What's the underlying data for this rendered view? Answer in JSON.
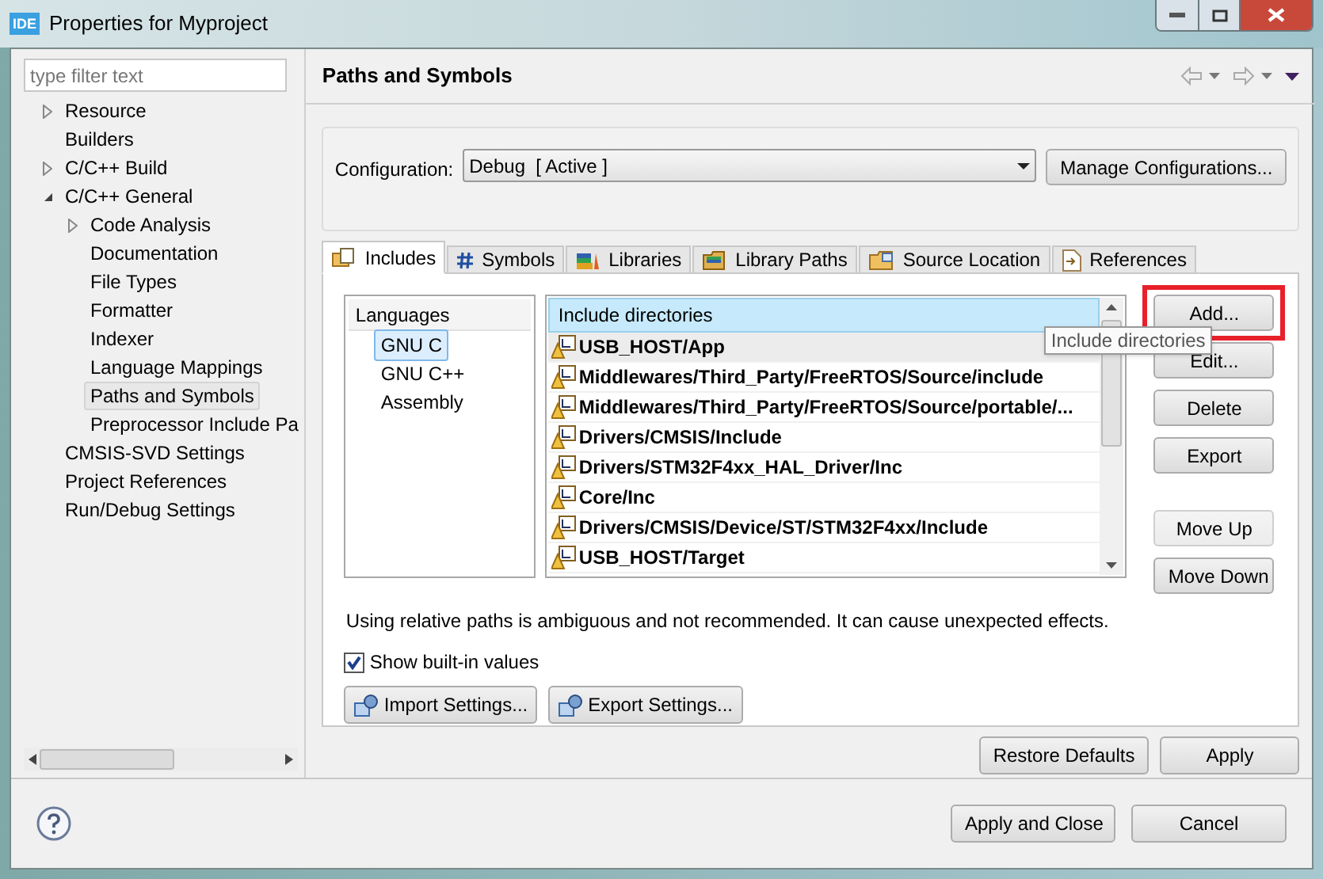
{
  "window": {
    "title": "Properties for Myproject",
    "app_badge": "IDE"
  },
  "filter": {
    "placeholder": "type filter text"
  },
  "tree": [
    {
      "label": "Resource",
      "expanded": false,
      "selected": false
    },
    {
      "label": "Builders",
      "selected": false
    },
    {
      "label": "C/C++ Build",
      "expanded": false,
      "selected": false
    },
    {
      "label": "C/C++ General",
      "expanded": true,
      "selected": false,
      "children": [
        {
          "label": "Code Analysis",
          "expanded": false,
          "selected": false
        },
        {
          "label": "Documentation",
          "selected": false
        },
        {
          "label": "File Types",
          "selected": false
        },
        {
          "label": "Formatter",
          "selected": false
        },
        {
          "label": "Indexer",
          "selected": false
        },
        {
          "label": "Language Mappings",
          "selected": false
        },
        {
          "label": "Paths and Symbols",
          "selected": true
        },
        {
          "label": "Preprocessor Include Pa",
          "selected": false
        }
      ]
    },
    {
      "label": "CMSIS-SVD Settings",
      "selected": false
    },
    {
      "label": "Project References",
      "selected": false
    },
    {
      "label": "Run/Debug Settings",
      "selected": false
    }
  ],
  "page": {
    "title": "Paths and Symbols"
  },
  "configuration": {
    "label": "Configuration:",
    "value": "Debug  [ Active ]",
    "manage_button": "Manage Configurations..."
  },
  "tabs": [
    {
      "label": "Includes",
      "selected": true
    },
    {
      "label": "Symbols",
      "selected": false
    },
    {
      "label": "Libraries",
      "selected": false
    },
    {
      "label": "Library Paths",
      "selected": false
    },
    {
      "label": "Source Location",
      "selected": false
    },
    {
      "label": "References",
      "selected": false
    }
  ],
  "languages": {
    "header": "Languages",
    "items": [
      {
        "label": "GNU C",
        "selected": true
      },
      {
        "label": "GNU C++",
        "selected": false
      },
      {
        "label": "Assembly",
        "selected": false
      }
    ]
  },
  "directories": {
    "header": "Include directories",
    "rows": [
      {
        "path": "USB_HOST/App",
        "selected": true
      },
      {
        "path": "Middlewares/Third_Party/FreeRTOS/Source/include",
        "selected": false
      },
      {
        "path": "Middlewares/Third_Party/FreeRTOS/Source/portable/...",
        "selected": false
      },
      {
        "path": "Drivers/CMSIS/Include",
        "selected": false
      },
      {
        "path": "Drivers/STM32F4xx_HAL_Driver/Inc",
        "selected": false
      },
      {
        "path": "Core/Inc",
        "selected": false
      },
      {
        "path": "Drivers/CMSIS/Device/ST/STM32F4xx/Include",
        "selected": false
      },
      {
        "path": "USB_HOST/Target",
        "selected": false
      }
    ]
  },
  "tooltip": "Include directories",
  "side_buttons": [
    {
      "label": "Add...",
      "disabled": false,
      "highlighted": true
    },
    {
      "label": "Edit...",
      "disabled": false,
      "highlighted": false
    },
    {
      "label": "Delete",
      "disabled": false,
      "highlighted": false
    },
    {
      "label": "Export",
      "disabled": false,
      "highlighted": false
    },
    {
      "label": "Move Up",
      "disabled": true,
      "highlighted": false
    },
    {
      "label": "Move Down",
      "disabled": false,
      "highlighted": false
    }
  ],
  "note": "Using relative paths is ambiguous and not recommended. It can cause unexpected effects.",
  "show_builtin": {
    "label": "Show built-in values",
    "checked": true
  },
  "settings_buttons": [
    "Import Settings...",
    "Export Settings..."
  ],
  "page_buttons": [
    "Restore Defaults",
    "Apply"
  ],
  "dialog_buttons": [
    {
      "label": "Apply and Close",
      "default": true
    },
    {
      "label": "Cancel",
      "default": false
    }
  ]
}
